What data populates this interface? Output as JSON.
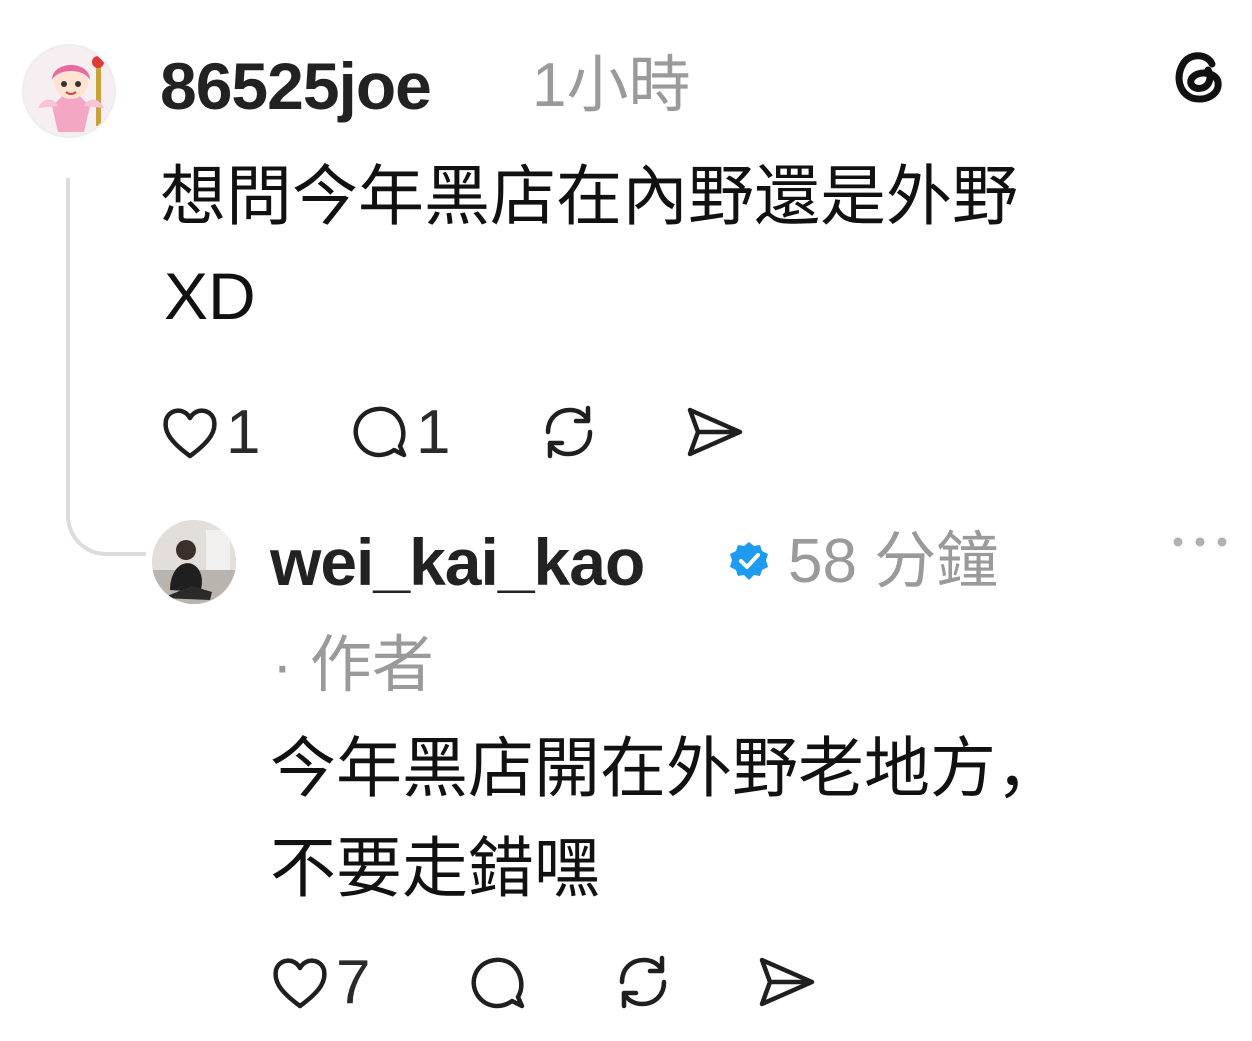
{
  "comment": {
    "username": "86525joe",
    "time": "1小時",
    "text_line1": "想問今年黑店在內野還是外野",
    "text_line2": "XD",
    "likes": "1",
    "replies": "1"
  },
  "reply": {
    "username": "wei_kai_kao",
    "time": "58 分鐘",
    "role": "· 作者",
    "text_line1": "今年黑店開在外野老地方，",
    "text_line2": "不要走錯嘿",
    "likes": "7"
  },
  "icons": {
    "app_logo": "threads-logo-icon",
    "more": "more-options-icon",
    "verified": "verified-badge-icon",
    "like": "heart-icon",
    "comment": "comment-icon",
    "repost": "repost-icon",
    "share": "send-icon"
  },
  "colors": {
    "verified_badge": "#1d9bf0",
    "muted_text": "#9a9a9a",
    "thread_line": "#dcdcdc"
  }
}
